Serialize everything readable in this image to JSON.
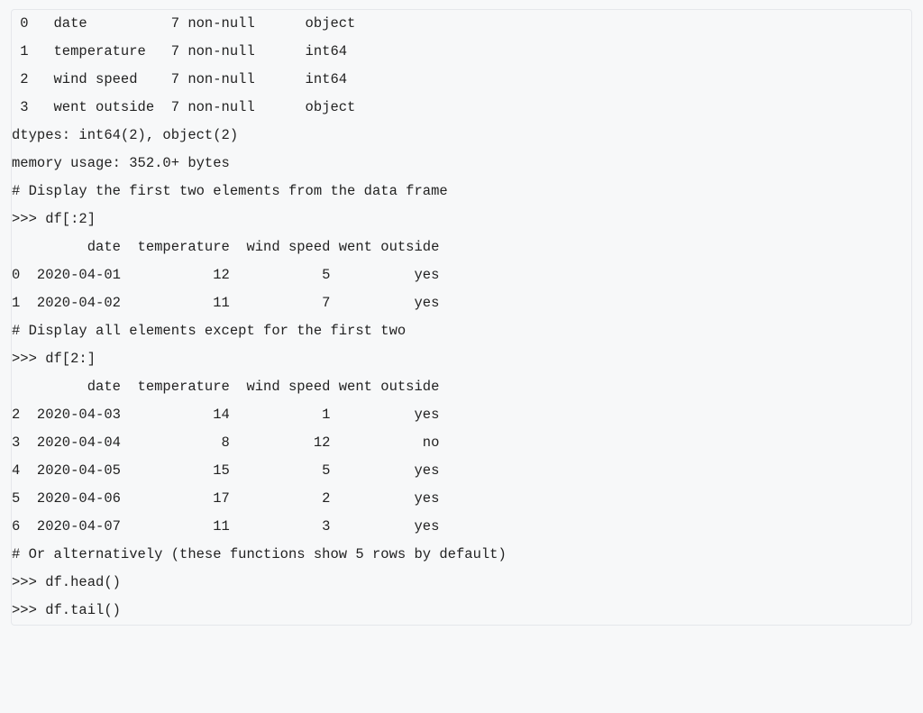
{
  "lines": [
    " 0   date          7 non-null      object",
    " 1   temperature   7 non-null      int64",
    " 2   wind speed    7 non-null      int64",
    " 3   went outside  7 non-null      object",
    "dtypes: int64(2), object(2)",
    "memory usage: 352.0+ bytes",
    "# Display the first two elements from the data frame",
    ">>> df[:2]",
    "         date  temperature  wind speed went outside",
    "0  2020-04-01           12           5          yes",
    "1  2020-04-02           11           7          yes",
    "# Display all elements except for the first two",
    ">>> df[2:]",
    "         date  temperature  wind speed went outside",
    "2  2020-04-03           14           1          yes",
    "3  2020-04-04            8          12           no",
    "4  2020-04-05           15           5          yes",
    "5  2020-04-06           17           2          yes",
    "6  2020-04-07           11           3          yes",
    "# Or alternatively (these functions show 5 rows by default)",
    ">>> df.head()",
    ">>> df.tail()"
  ],
  "chart_data": {
    "type": "table",
    "info_columns": [
      {
        "idx": 0,
        "name": "date",
        "non_null": 7,
        "dtype": "object"
      },
      {
        "idx": 1,
        "name": "temperature",
        "non_null": 7,
        "dtype": "int64"
      },
      {
        "idx": 2,
        "name": "wind speed",
        "non_null": 7,
        "dtype": "int64"
      },
      {
        "idx": 3,
        "name": "went outside",
        "non_null": 7,
        "dtype": "object"
      }
    ],
    "dtypes_summary": {
      "int64": 2,
      "object": 2
    },
    "memory_usage": "352.0+ bytes",
    "columns": [
      "date",
      "temperature",
      "wind speed",
      "went outside"
    ],
    "rows": [
      {
        "index": 0,
        "date": "2020-04-01",
        "temperature": 12,
        "wind speed": 5,
        "went outside": "yes"
      },
      {
        "index": 1,
        "date": "2020-04-02",
        "temperature": 11,
        "wind speed": 7,
        "went outside": "yes"
      },
      {
        "index": 2,
        "date": "2020-04-03",
        "temperature": 14,
        "wind speed": 1,
        "went outside": "yes"
      },
      {
        "index": 3,
        "date": "2020-04-04",
        "temperature": 8,
        "wind speed": 12,
        "went outside": "no"
      },
      {
        "index": 4,
        "date": "2020-04-05",
        "temperature": 15,
        "wind speed": 5,
        "went outside": "yes"
      },
      {
        "index": 5,
        "date": "2020-04-06",
        "temperature": 17,
        "wind speed": 2,
        "went outside": "yes"
      },
      {
        "index": 6,
        "date": "2020-04-07",
        "temperature": 11,
        "wind speed": 3,
        "went outside": "yes"
      }
    ],
    "slice_first_two": [
      0,
      1
    ],
    "slice_from_two": [
      2,
      3,
      4,
      5,
      6
    ],
    "commands": [
      "df[:2]",
      "df[2:]",
      "df.head()",
      "df.tail()"
    ]
  }
}
